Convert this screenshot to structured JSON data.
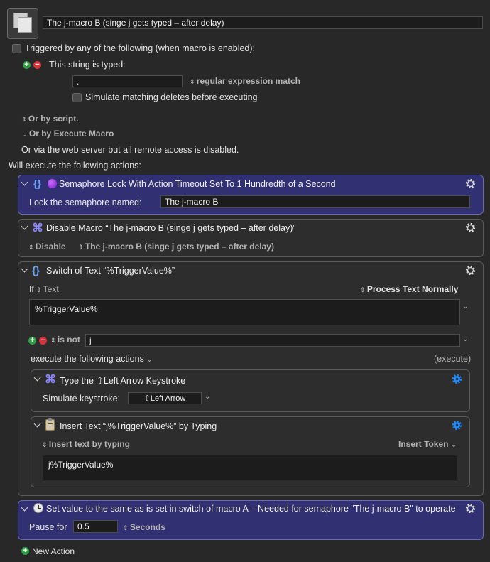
{
  "macro": {
    "name": "The j-macro B (singe j gets typed – after delay)"
  },
  "trigger": {
    "header": "Triggered by any of the following (when macro is enabled):",
    "string_label": "This string is typed:",
    "string_value": ".",
    "match_mode": "regular expression match",
    "simulate_deletes": "Simulate matching deletes before executing",
    "or_script": "Or by script.",
    "or_execute": "Or by Execute Macro",
    "web_server": "Or via the web server but all remote access is disabled."
  },
  "actions_header": "Will execute the following actions:",
  "action1": {
    "title": "Semaphore Lock With Action Timeout Set To 1 Hundredth of a Second",
    "label": "Lock the semaphore named:",
    "value": "The j-macro B"
  },
  "action2": {
    "title": "Disable Macro “The j-macro B (singe j gets typed – after delay)”",
    "mode": "Disable",
    "target": "The j-macro B (singe j gets typed – after delay)"
  },
  "action3": {
    "title": "Switch of Text “%TriggerValue%”",
    "if_label": "If",
    "source": "Text",
    "process": "Process Text Normally",
    "text": "%TriggerValue%",
    "condition": "is not",
    "match_value": "j",
    "execute_label": "execute the following actions",
    "execute_hint": "(execute)"
  },
  "action3a": {
    "title": "Type the ⇧Left Arrow Keystroke",
    "label": "Simulate keystroke:",
    "keystroke": "⇧Left Arrow"
  },
  "action3b": {
    "title": "Insert Text “j%TriggerValue%” by Typing",
    "mode": "Insert text by typing",
    "token": "Insert Token",
    "text": "j%TriggerValue%"
  },
  "action4": {
    "title": "Set value to the same as is set in switch of macro A – Needed for semaphore \"The j-macro B\" to operate",
    "pause_label": "Pause for",
    "pause_value": "0.5",
    "unit": "Seconds"
  },
  "new_action": "New Action",
  "colors": {
    "background": "#282828",
    "selected_panel": "#303072",
    "plus": "#2ea043",
    "minus": "#d8333a",
    "gear_highlight": "#1e8cff"
  }
}
